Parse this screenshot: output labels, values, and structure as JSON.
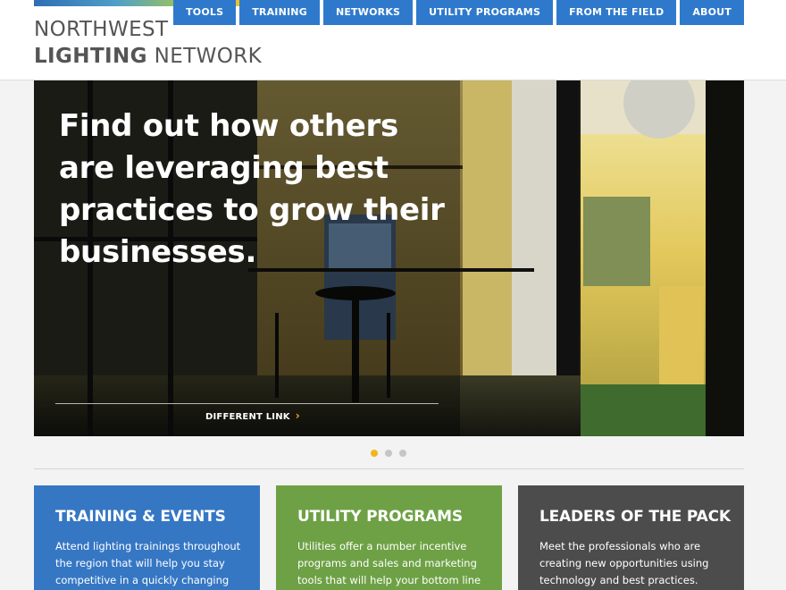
{
  "brand": {
    "line1": "NORTHWEST",
    "line2_bold": "LIGHTING",
    "line2_rest": " NETWORK"
  },
  "nav": [
    {
      "label": "TOOLS"
    },
    {
      "label": "TRAINING"
    },
    {
      "label": "NETWORKS"
    },
    {
      "label": "UTILITY PROGRAMS"
    },
    {
      "label": "FROM THE FIELD"
    },
    {
      "label": "ABOUT"
    }
  ],
  "hero": {
    "headline": "Find out how others are leveraging best practices to grow their businesses.",
    "link_label": "DIFFERENT LINK",
    "chevron": "›"
  },
  "slider": {
    "total": 3,
    "active": 1
  },
  "cards": [
    {
      "title": "TRAINING & EVENTS",
      "text": "Attend lighting trainings throughout the region that will help you stay competitive in a quickly changing",
      "color": "#3677c4"
    },
    {
      "title": "UTILITY PROGRAMS",
      "text": "Utilities offer a number incentive programs and sales and marketing tools that will help your bottom line",
      "color": "#6ea145"
    },
    {
      "title": "LEADERS OF THE PACK",
      "text": "Meet the professionals who are creating new opportunities using technology and best practices.",
      "color": "#4c4c4c"
    }
  ],
  "colors": {
    "nav_blue": "#2f79cc",
    "accent_yellow": "#f2b51c"
  }
}
